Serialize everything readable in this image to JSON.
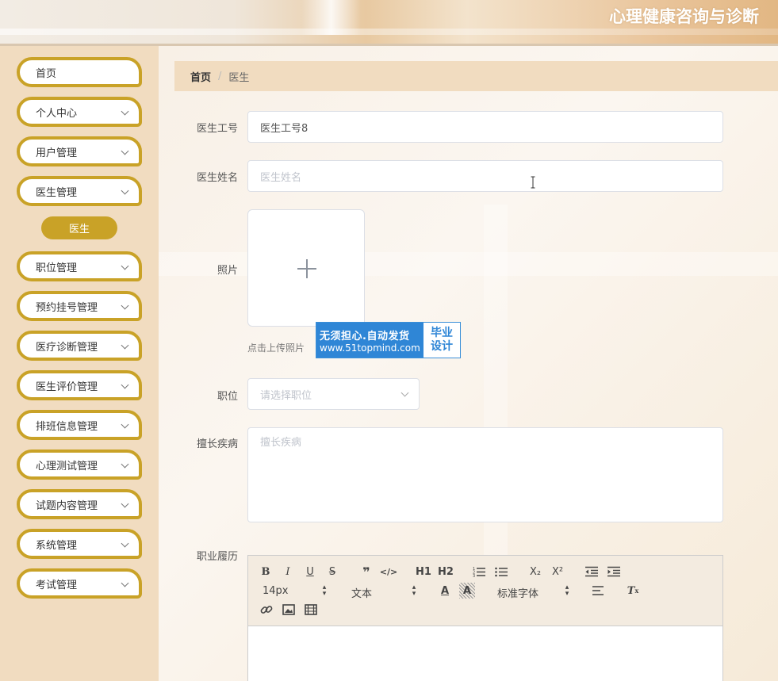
{
  "header": {
    "title": "心理健康咨询与诊断"
  },
  "sidebar": {
    "items": [
      {
        "label": "首页",
        "expandable": false
      },
      {
        "label": "个人中心",
        "expandable": true
      },
      {
        "label": "用户管理",
        "expandable": true
      },
      {
        "label": "医生管理",
        "expandable": true
      },
      {
        "label": "职位管理",
        "expandable": true
      },
      {
        "label": "预约挂号管理",
        "expandable": true
      },
      {
        "label": "医疗诊断管理",
        "expandable": true
      },
      {
        "label": "医生评价管理",
        "expandable": true
      },
      {
        "label": "排班信息管理",
        "expandable": true
      },
      {
        "label": "心理测试管理",
        "expandable": true
      },
      {
        "label": "试题内容管理",
        "expandable": true
      },
      {
        "label": "系统管理",
        "expandable": true
      },
      {
        "label": "考试管理",
        "expandable": true
      }
    ],
    "active_submenu": "医生"
  },
  "breadcrumb": {
    "home": "首页",
    "separator": "/",
    "current": "医生"
  },
  "form": {
    "doctor_id": {
      "label": "医生工号",
      "value": "医生工号8"
    },
    "doctor_name": {
      "label": "医生姓名",
      "placeholder": "医生姓名"
    },
    "photo": {
      "label": "照片",
      "hint": "点击上传照片"
    },
    "position": {
      "label": "职位",
      "placeholder": "请选择职位"
    },
    "specialty": {
      "label": "擅长疾病",
      "placeholder": "擅长疾病"
    },
    "resume": {
      "label": "职业履历"
    }
  },
  "editor_toolbar": {
    "row1": [
      "B",
      "I",
      "U",
      "S",
      "❞",
      "</>",
      "H1",
      "H2",
      "ordered-list",
      "bullet-list",
      "X₂",
      "X²",
      "outdent",
      "indent"
    ],
    "font_size": "14px",
    "header_select": "文本",
    "font_family": "标准字体"
  },
  "watermark": {
    "line1": "无须担心.自动发货",
    "line2": "www.51topmind.com",
    "right1": "毕业",
    "right2": "设计"
  },
  "colors": {
    "accent": "#c9a227",
    "sidebar_bg": "#f1dcc0",
    "watermark_blue": "#2f86d6"
  }
}
